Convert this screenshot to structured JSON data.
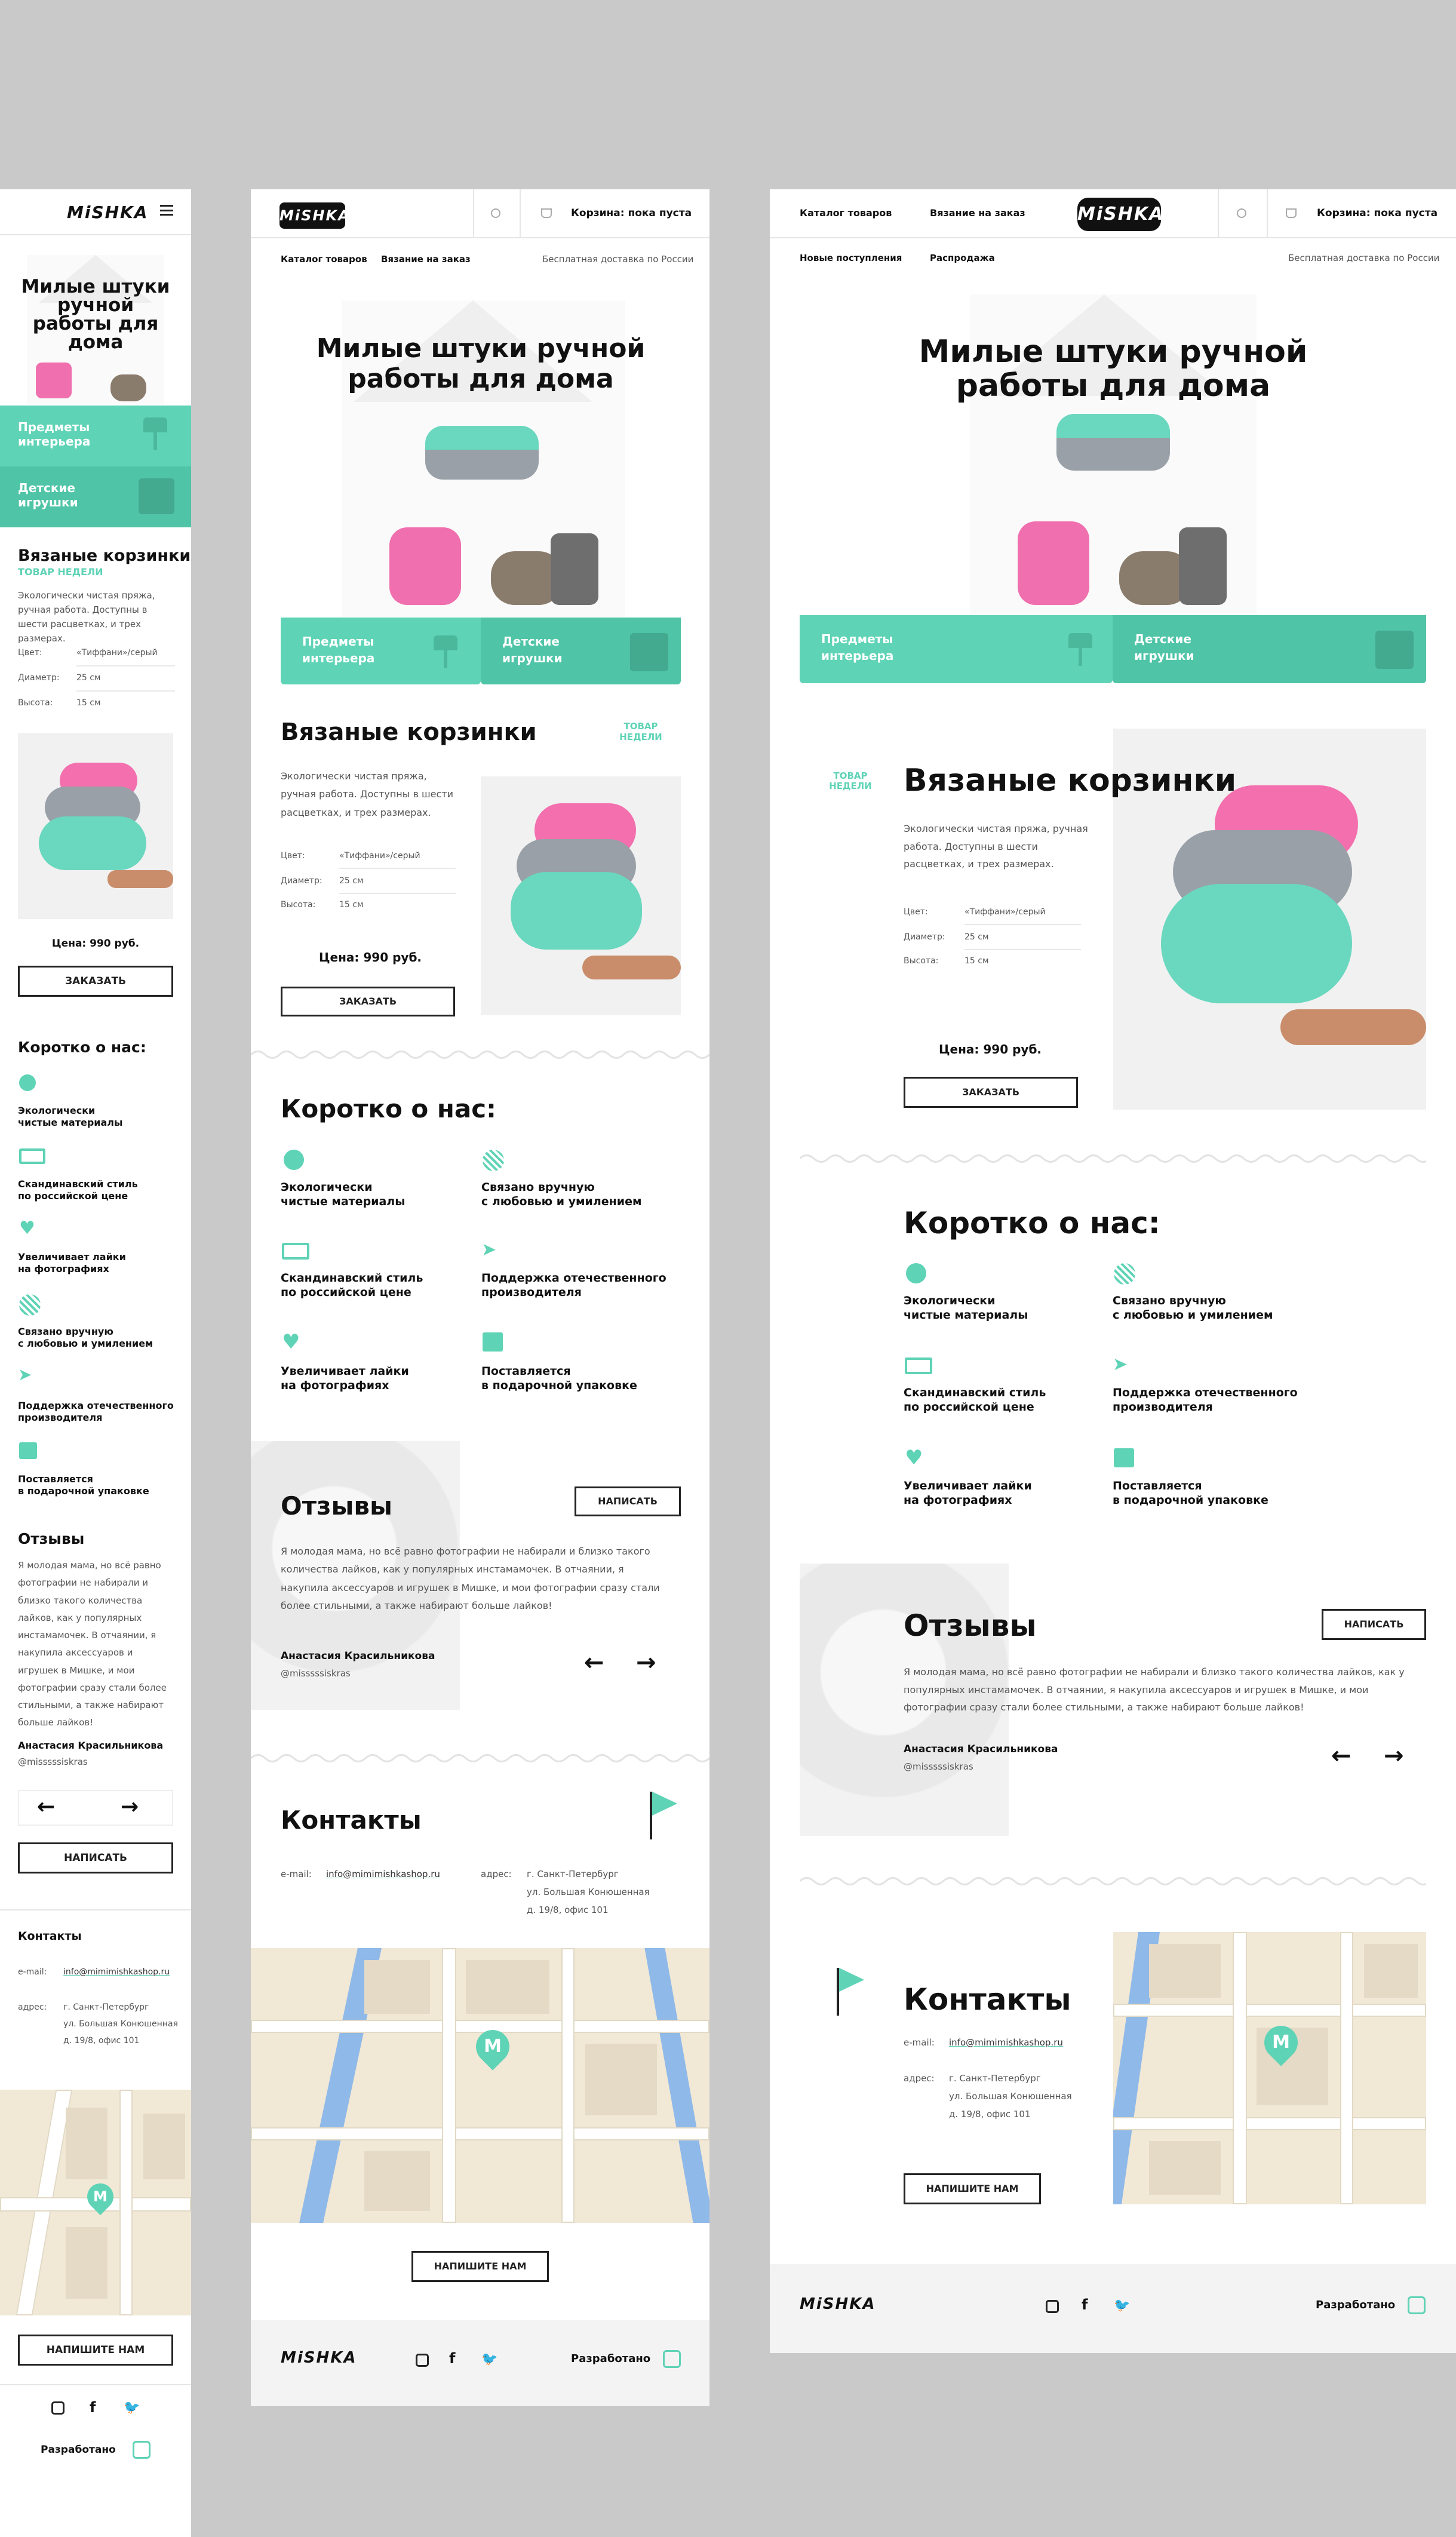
{
  "brand": {
    "logo": "MiSHKA",
    "teal": "#5fd3b6",
    "dark": "#111111"
  },
  "header": {
    "cart": "Корзина: пока пуста",
    "nav_catalog": "Каталог товаров",
    "nav_custom": "Вязание на заказ",
    "nav_new": "Новые поступления",
    "nav_sale": "Распродажа",
    "delivery": "Бесплатная доставка по России"
  },
  "hero": {
    "title": "Милые штуки ручной работы для дома",
    "cat_interior": "Предметы интерьера",
    "cat_toys": "Детские игрушки"
  },
  "product": {
    "title": "Вязаные корзинки",
    "badge": "ТОВАР НЕДЕЛИ",
    "desc": "Экологически чистая пряжа, ручная работа. Доступны в шести расцветках, и трех размерах.",
    "specs": [
      {
        "label": "Цвет:",
        "value": "«Тиффани»/серый"
      },
      {
        "label": "Диаметр:",
        "value": "25 см"
      },
      {
        "label": "Высота:",
        "value": "15 см"
      }
    ],
    "price": "Цена: 990 руб.",
    "order": "ЗАКАЗАТЬ"
  },
  "about": {
    "title": "Коротко о нас:",
    "features": [
      {
        "l1": "Экологически",
        "l2": "чистые материалы",
        "icon": "flower-icon"
      },
      {
        "l1": "Связано вручную",
        "l2": "с любовью и умилением",
        "icon": "yarn-icon"
      },
      {
        "l1": "Скандинавский стиль",
        "l2": "по российской цене",
        "icon": "money-icon"
      },
      {
        "l1": "Поддержка отечественного",
        "l2": "производителя",
        "icon": "rocket-icon"
      },
      {
        "l1": "Увеличивает лайки",
        "l2": "на фотографиях",
        "icon": "heart-icon"
      },
      {
        "l1": "Поставляется",
        "l2": "в подарочной упаковке",
        "icon": "gift-icon"
      }
    ]
  },
  "reviews": {
    "title": "Отзывы",
    "write": "НАПИСАТЬ",
    "text": "Я молодая мама, но всё равно фотографии не набирали и близко такого количества лайков, как у популярных инстамамочек. В отчаянии, я накупила аксессуаров и игрушек в Мишке, и мои фотографии сразу стали более стильными, а также набирают больше лайков!",
    "author": "Анастасия Красильникова",
    "handle": "@misssssiskras",
    "prev": "←",
    "next": "→"
  },
  "contacts": {
    "title": "Контакты",
    "title_mobile": "Контакты",
    "email_label": "e-mail:",
    "email": "info@mimimishkashop.ru",
    "addr_label": "адрес:",
    "addr1": "г. Санкт-Петербург",
    "addr2": "ул. Большая Конюшенная",
    "addr3": "д. 19/8, офис 101",
    "cta": "НАПИШИТЕ НАМ"
  },
  "map": {
    "marker": "M"
  },
  "footer": {
    "credit": "Разработано"
  }
}
